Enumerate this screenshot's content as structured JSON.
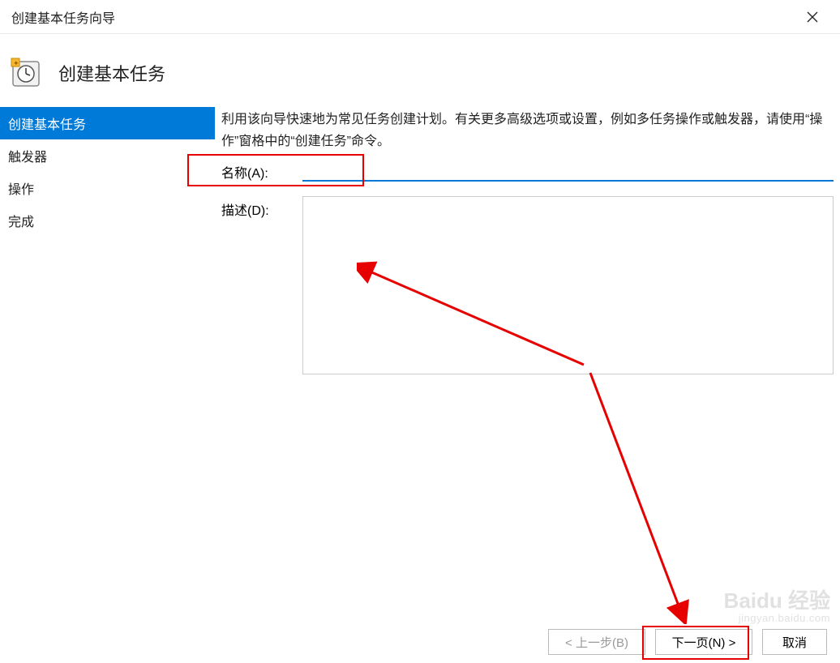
{
  "titlebar": {
    "title": "创建基本任务向导"
  },
  "header": {
    "heading": "创建基本任务"
  },
  "sidebar": {
    "items": [
      {
        "label": "创建基本任务",
        "active": true
      },
      {
        "label": "触发器",
        "active": false
      },
      {
        "label": "操作",
        "active": false
      },
      {
        "label": "完成",
        "active": false
      }
    ]
  },
  "content": {
    "intro": "利用该向导快速地为常见任务创建计划。有关更多高级选项或设置，例如多任务操作或触发器，请使用“操作”窗格中的“创建任务”命令。",
    "name_label": "名称(A):",
    "name_value": "",
    "desc_label": "描述(D):",
    "desc_value": ""
  },
  "footer": {
    "back": "< 上一步(B)",
    "next": "下一页(N) >",
    "cancel": "取消"
  },
  "watermark": {
    "brand": "Baidu 经验",
    "url": "jingyan.baidu.com"
  }
}
